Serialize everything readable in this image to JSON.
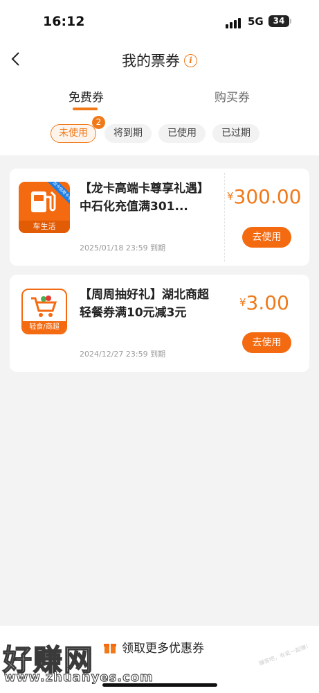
{
  "status_bar": {
    "time": "16:12",
    "network": "5G",
    "battery": "34"
  },
  "header": {
    "title": "我的票券",
    "info_icon": "info-icon"
  },
  "tabs": [
    {
      "label": "免费券",
      "active": true
    },
    {
      "label": "购买券",
      "active": false
    }
  ],
  "filters": {
    "items": [
      {
        "label": "未使用",
        "active": true
      },
      {
        "label": "将到期",
        "active": false
      },
      {
        "label": "已使用",
        "active": false
      },
      {
        "label": "已过期",
        "active": false
      }
    ],
    "badge_count": "2"
  },
  "coupons": [
    {
      "title": "【龙卡高端卡尊享礼遇】中石化充值满301...",
      "expiry": "2025/01/18 23:59 到期",
      "currency": "¥",
      "amount": "300.00",
      "button": "去使用",
      "icon_label": "车生活",
      "icon_ribbon": "龙卡信用卡专享",
      "icon": "fuel-pump-icon"
    },
    {
      "title": "【周周抽好礼】湖北商超轻餐券满10元减3元",
      "expiry": "2024/12/27 23:59 到期",
      "currency": "¥",
      "amount": "3.00",
      "button": "去使用",
      "icon_label": "轻食/商超",
      "icon": "shopping-cart-icon"
    }
  ],
  "footer": {
    "more_label": "领取更多优惠券"
  },
  "watermark": {
    "text": "好赚网",
    "url": "www.zhuanyes.com",
    "side_text": "赚客吧，有奖一起赚！"
  },
  "colors": {
    "accent": "#f07a1a",
    "button": "#f36a10"
  }
}
